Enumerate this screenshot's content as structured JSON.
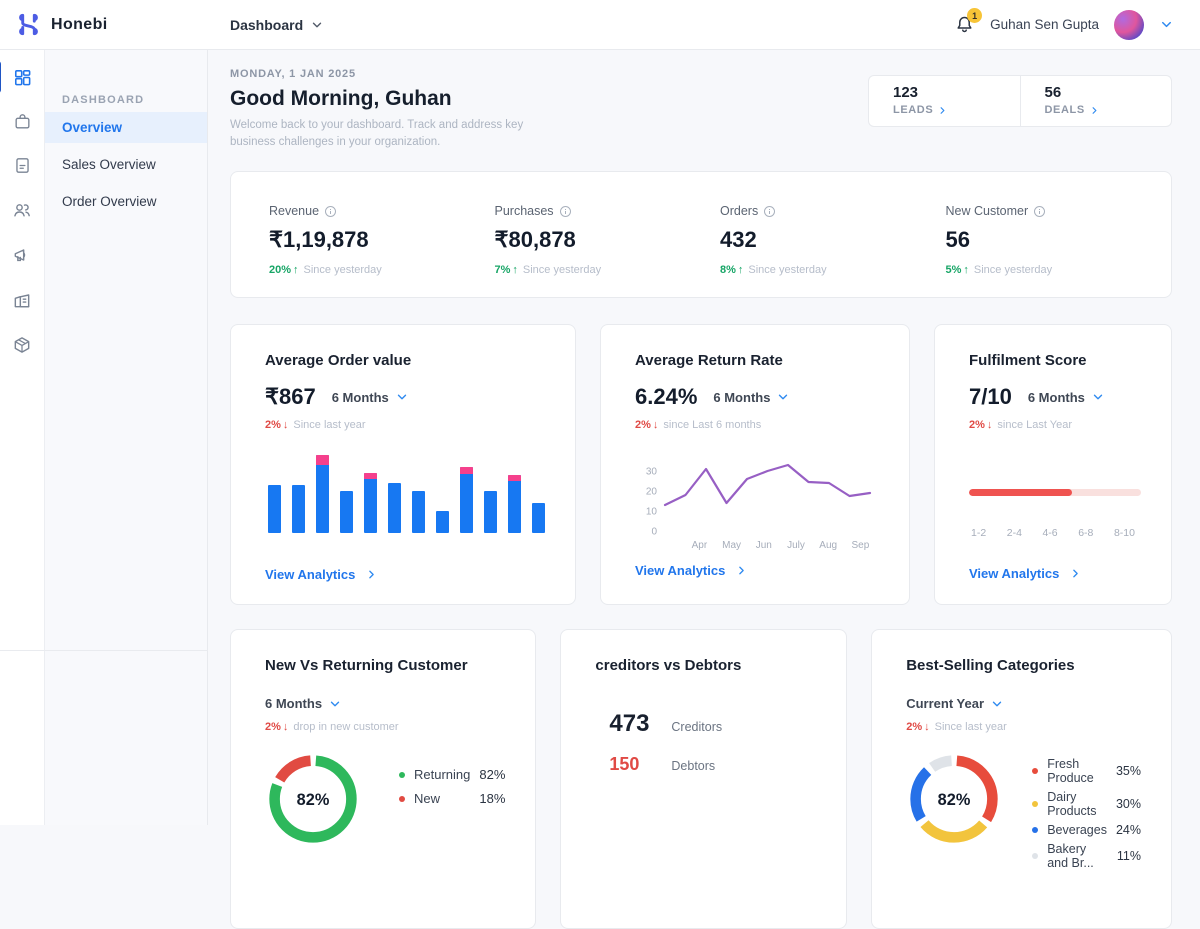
{
  "topbar": {
    "brand": "Honebi",
    "nav": "Dashboard",
    "user": "Guhan Sen Gupta",
    "badge": "1"
  },
  "sidebar": {
    "section": "DASHBOARD",
    "items": [
      "Overview",
      "Sales Overview",
      "Order Overview"
    ]
  },
  "header": {
    "date": "MONDAY, 1 JAN 2025",
    "greeting": "Good Morning, Guhan",
    "subtitle": "Welcome back to your dashboard. Track and address key business challenges in your organization."
  },
  "quick": {
    "leads_value": "123",
    "leads_label": "LEADS",
    "deals_value": "56",
    "deals_label": "DEALS"
  },
  "kpis": [
    {
      "label": "Revenue",
      "value": "₹1,19,878",
      "delta": "20%",
      "arrow": "↑",
      "note": "Since yesterday"
    },
    {
      "label": "Purchases",
      "value": "₹80,878",
      "delta": "7%",
      "arrow": "↑",
      "note": "Since yesterday"
    },
    {
      "label": "Orders",
      "value": "432",
      "delta": "8%",
      "arrow": "↑",
      "note": "Since yesterday"
    },
    {
      "label": "New Customer",
      "value": "56",
      "delta": "5%",
      "arrow": "↑",
      "note": "Since yesterday"
    }
  ],
  "cards": {
    "avg_order": {
      "title": "Average Order value",
      "value": "₹867",
      "period": "6 Months",
      "delta": "2%",
      "arrow": "↓",
      "note": "Since last year",
      "link": "View Analytics",
      "chart_data": {
        "type": "bar",
        "values": [
          60,
          60,
          97,
          52,
          75,
          62,
          53,
          28,
          83,
          53,
          73,
          38
        ],
        "highlight": [
          0,
          0,
          13,
          0,
          8,
          0,
          0,
          0,
          9,
          0,
          8,
          0
        ],
        "bar_color": "#1778f2",
        "highlight_color": "#f5408c"
      }
    },
    "return_rate": {
      "title": "Average Return Rate",
      "value": "6.24%",
      "period": "6 Months",
      "delta": "2%",
      "arrow": "↓",
      "note": "since Last 6 months",
      "link": "View Analytics",
      "chart_data": {
        "type": "line",
        "values": [
          13,
          18,
          31,
          14,
          26,
          30,
          33,
          24.5,
          24,
          17.5,
          19
        ],
        "yticks": [
          0,
          10,
          20,
          30
        ],
        "ylim": [
          0,
          35
        ],
        "xlabels": [
          "Apr",
          "May",
          "Jun",
          "July",
          "Aug",
          "Sep"
        ],
        "line_color": "#975fc4"
      }
    },
    "fulfilment": {
      "title": "Fulfilment Score",
      "value": "7/10",
      "period": "6 Months",
      "delta": "2%",
      "arrow": "↓",
      "note": "since Last Year",
      "link": "View Analytics",
      "chart_data": {
        "type": "progress",
        "fill_pct": 60,
        "fill_color": "#ef5350",
        "track_color": "#f9e0de",
        "scale_labels": [
          "1-2",
          "2-4",
          "4-6",
          "6-8",
          "8-10"
        ]
      }
    },
    "customers": {
      "title": "New Vs Returning Customer",
      "period": "6 Months",
      "delta": "2%",
      "arrow": "↓",
      "note": "drop in new customer",
      "chart_data": {
        "type": "pie",
        "center_label": "82%",
        "segments": [
          {
            "label": "Returning",
            "pct": 82,
            "display": "82%",
            "color": "#2eb85c"
          },
          {
            "label": "New",
            "pct": 18,
            "display": "18%",
            "color": "#e14b42"
          }
        ]
      }
    },
    "creditors": {
      "title": "creditors vs Debtors",
      "rows": [
        {
          "value": "473",
          "label": "Creditors"
        },
        {
          "value": "150",
          "label": "Debtors"
        }
      ]
    },
    "categories": {
      "title": "Best-Selling Categories",
      "period": "Current Year",
      "delta": "2%",
      "arrow": "↓",
      "note": "Since last year",
      "chart_data": {
        "type": "pie",
        "center_label": "82%",
        "segments": [
          {
            "label": "Fresh Produce",
            "pct": 35,
            "display": "35%",
            "color": "#e74c3c"
          },
          {
            "label": "Dairy Products",
            "pct": 30,
            "display": "30%",
            "color": "#f2c43d"
          },
          {
            "label": "Beverages",
            "pct": 24,
            "display": "24%",
            "color": "#2671e8"
          },
          {
            "label": "Bakery and Br...",
            "pct": 11,
            "display": "11%",
            "color": "#dfe3e8"
          }
        ]
      }
    }
  }
}
